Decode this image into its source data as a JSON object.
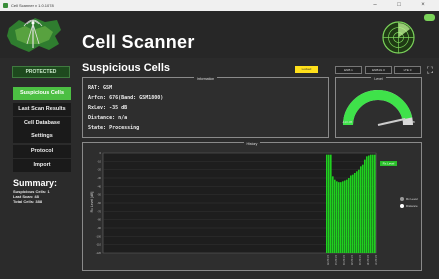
{
  "window": {
    "title": "Cell Scanner v 1.0.1078",
    "minimize": "–",
    "maximize": "□",
    "close": "×"
  },
  "app": {
    "title": "Cell Scanner"
  },
  "status": {
    "protected": "PROTECTED"
  },
  "nav": [
    {
      "label": "Suspicious Cells",
      "active": true
    },
    {
      "label": "Last Scan Results",
      "active": false
    },
    {
      "label": "Cell Database",
      "active": false
    },
    {
      "label": "Settings",
      "active": false
    },
    {
      "label": "Protocol",
      "active": false
    },
    {
      "label": "Import",
      "active": false
    }
  ],
  "summary": {
    "title": "Summary:",
    "lines": [
      "Suspicious Cells: 1",
      "Last Scan: 48",
      "Total Cells: 388"
    ]
  },
  "page": {
    "title": "Suspicious Cells",
    "badge": "Locked"
  },
  "top_buttons": [
    "ENB 1",
    "ENB1G 0",
    "LTE 0"
  ],
  "information": {
    "title": "Information",
    "lines": [
      "RAT: GSM",
      "Arfcn: 676(Band: GSM1800)",
      "RxLev: -35 dB",
      "Distance: n/a",
      "State: Processing"
    ]
  },
  "level": {
    "title": "Level",
    "min_label": "-110 dB",
    "max_label": "-34 dB",
    "value_fraction": 0.93
  },
  "history": {
    "title": "History",
    "ylabel": "Rx Level [dB]",
    "y_ticks": [
      "0",
      "-10",
      "-20",
      "-30",
      "-40",
      "-50",
      "-60",
      "-70",
      "-80",
      "-90",
      "-100",
      "-110",
      "-120"
    ],
    "legend": {
      "series": "Rx Level",
      "options": [
        "Rx Level",
        "Distance"
      ]
    },
    "x_labels": [
      "10:32:05",
      "10:32:12",
      "10:32:19",
      "10:32:26",
      "10:32:33",
      "10:32:40",
      "10:32:47"
    ]
  },
  "chart_data": {
    "type": "bar",
    "title": "History",
    "ylabel": "Rx Level [dB]",
    "ylim": [
      -120,
      0
    ],
    "series": [
      {
        "name": "Rx Level",
        "values": [
          -2,
          -2,
          -2,
          -28,
          -32,
          -34,
          -35,
          -35,
          -34,
          -33,
          -32,
          -30,
          -27,
          -26,
          -24,
          -22,
          -20,
          -16,
          -14,
          -8,
          -4,
          -3,
          -2,
          -2,
          -2
        ]
      }
    ]
  },
  "colors": {
    "accent": "#4cbf43",
    "badge": "#ffe01b",
    "bars": "#1fd01f"
  }
}
